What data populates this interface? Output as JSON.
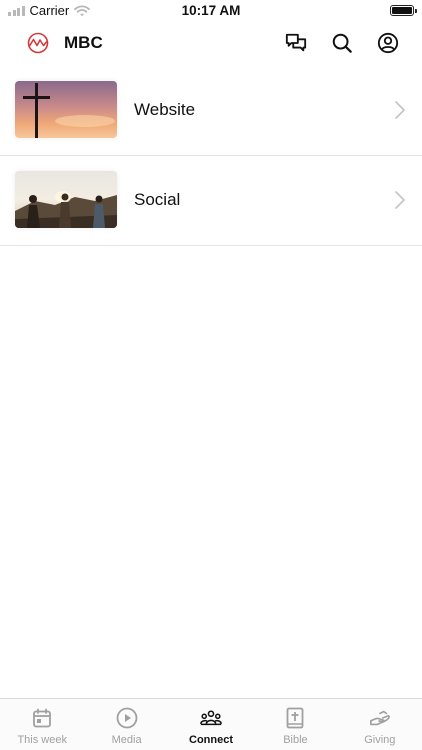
{
  "status_bar": {
    "carrier": "Carrier",
    "time": "10:17 AM"
  },
  "header": {
    "title": "MBC",
    "logo_color": "#d43a3a"
  },
  "list": {
    "items": [
      {
        "label": "Website",
        "thumbnail": "cross-sunset-image"
      },
      {
        "label": "Social",
        "thumbnail": "people-sunset-image"
      }
    ]
  },
  "tab_bar": {
    "active_color": "#111111",
    "inactive_color": "#a0a0a0",
    "tabs": [
      {
        "label": "This week",
        "icon": "calendar-icon",
        "active": false
      },
      {
        "label": "Media",
        "icon": "play-circle-icon",
        "active": false
      },
      {
        "label": "Connect",
        "icon": "people-group-icon",
        "active": true
      },
      {
        "label": "Bible",
        "icon": "bible-icon",
        "active": false
      },
      {
        "label": "Giving",
        "icon": "giving-hand-icon",
        "active": false
      }
    ]
  }
}
